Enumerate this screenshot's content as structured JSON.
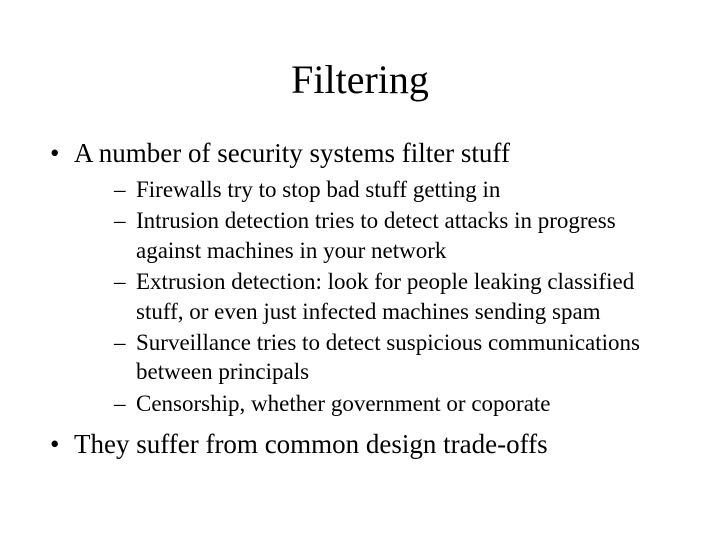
{
  "title": "Filtering",
  "bullets": {
    "b1": "A number of security systems filter stuff",
    "b2": "They suffer from common design trade-offs"
  },
  "sub": {
    "s1": "Firewalls try to stop bad stuff getting in",
    "s2": "Intrusion detection tries to detect attacks in progress against machines in your network",
    "s3": "Extrusion detection: look for people leaking classified stuff, or even just infected machines sending spam",
    "s4": "Surveillance tries to detect suspicious communications between principals",
    "s5": "Censorship, whether government or coporate"
  }
}
